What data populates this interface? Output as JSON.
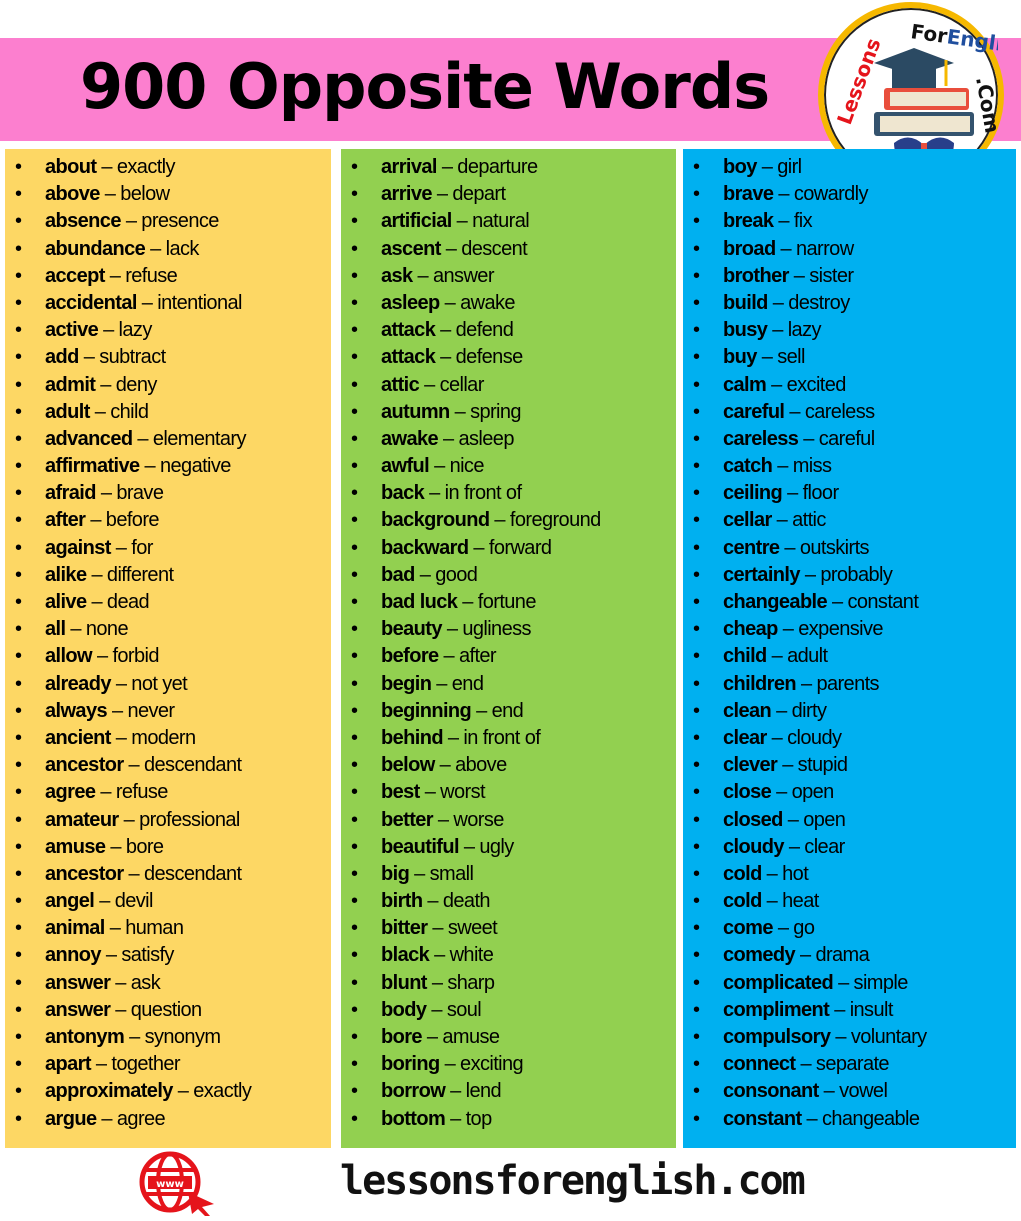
{
  "header": {
    "title": "900 Opposite Words"
  },
  "logo": {
    "text": "LessonsForEnglish.Com"
  },
  "footer": {
    "url": "lessonsforenglish.com",
    "icon": "www-globe-icon"
  },
  "colors": {
    "banner": "#fc7fcf",
    "column1": "#fdd764",
    "column2": "#92d050",
    "column3": "#00b0f0"
  },
  "columns": [
    [
      [
        "about",
        "exactly"
      ],
      [
        "above",
        "below"
      ],
      [
        "absence",
        "presence"
      ],
      [
        "abundance",
        "lack"
      ],
      [
        "accept",
        "refuse"
      ],
      [
        "accidental",
        "intentional"
      ],
      [
        "active",
        "lazy"
      ],
      [
        "add",
        "subtract"
      ],
      [
        "admit",
        "deny"
      ],
      [
        "adult",
        "child"
      ],
      [
        "advanced",
        "elementary"
      ],
      [
        "affirmative",
        "negative"
      ],
      [
        "afraid",
        "brave"
      ],
      [
        "after",
        "before"
      ],
      [
        "against",
        "for"
      ],
      [
        "alike",
        "different"
      ],
      [
        "alive",
        "dead"
      ],
      [
        "all",
        "none"
      ],
      [
        "allow",
        "forbid"
      ],
      [
        "already",
        "not yet"
      ],
      [
        "always",
        "never"
      ],
      [
        "ancient",
        "modern"
      ],
      [
        "ancestor",
        "descendant"
      ],
      [
        "agree",
        "refuse"
      ],
      [
        "amateur",
        "professional"
      ],
      [
        "amuse",
        "bore"
      ],
      [
        "ancestor",
        "descendant"
      ],
      [
        "angel",
        "devil"
      ],
      [
        "animal",
        "human"
      ],
      [
        "annoy",
        "satisfy"
      ],
      [
        "answer",
        "ask"
      ],
      [
        "answer",
        "question"
      ],
      [
        "antonym",
        "synonym"
      ],
      [
        "apart",
        "together"
      ],
      [
        "approximately",
        "exactly"
      ],
      [
        "argue",
        "agree"
      ]
    ],
    [
      [
        "arrival",
        "departure"
      ],
      [
        "arrive",
        "depart"
      ],
      [
        "artificial",
        "natural"
      ],
      [
        "ascent",
        "descent"
      ],
      [
        "ask",
        "answer"
      ],
      [
        "asleep",
        "awake"
      ],
      [
        "attack",
        "defend"
      ],
      [
        "attack",
        "defense"
      ],
      [
        "attic",
        "cellar"
      ],
      [
        "autumn",
        "spring"
      ],
      [
        "awake",
        "asleep"
      ],
      [
        "awful",
        "nice"
      ],
      [
        "back",
        "in front of"
      ],
      [
        "background",
        "foreground"
      ],
      [
        "backward",
        "forward"
      ],
      [
        "bad",
        "good"
      ],
      [
        "bad luck",
        "fortune"
      ],
      [
        "beauty",
        "ugliness"
      ],
      [
        "before",
        "after"
      ],
      [
        "begin",
        "end"
      ],
      [
        "beginning",
        "end"
      ],
      [
        "behind",
        "in front of"
      ],
      [
        "below",
        "above"
      ],
      [
        "best",
        "worst"
      ],
      [
        "better",
        "worse"
      ],
      [
        "beautiful",
        "ugly"
      ],
      [
        "big",
        "small"
      ],
      [
        "birth",
        "death"
      ],
      [
        "bitter",
        "sweet"
      ],
      [
        "black",
        "white"
      ],
      [
        "blunt",
        "sharp"
      ],
      [
        "body",
        "soul"
      ],
      [
        "bore",
        "amuse"
      ],
      [
        "boring",
        "exciting"
      ],
      [
        "borrow",
        "lend"
      ],
      [
        "bottom",
        "top"
      ]
    ],
    [
      [
        "boy",
        "girl"
      ],
      [
        "brave",
        "cowardly"
      ],
      [
        "break",
        "fix"
      ],
      [
        "broad",
        "narrow"
      ],
      [
        "brother",
        "sister"
      ],
      [
        "build",
        "destroy"
      ],
      [
        "busy",
        "lazy"
      ],
      [
        "buy",
        "sell"
      ],
      [
        "calm",
        "excited"
      ],
      [
        "careful",
        "careless"
      ],
      [
        "careless",
        "careful"
      ],
      [
        "catch",
        "miss"
      ],
      [
        "ceiling",
        "floor"
      ],
      [
        "cellar",
        "attic"
      ],
      [
        "centre",
        "outskirts"
      ],
      [
        "certainly",
        "probably"
      ],
      [
        "changeable",
        "constant"
      ],
      [
        "cheap",
        "expensive"
      ],
      [
        "child",
        "adult"
      ],
      [
        "children",
        "parents"
      ],
      [
        "clean",
        "dirty"
      ],
      [
        "clear",
        "cloudy"
      ],
      [
        "clever",
        "stupid"
      ],
      [
        "close",
        "open"
      ],
      [
        "closed",
        "open"
      ],
      [
        "cloudy",
        "clear"
      ],
      [
        "cold",
        "hot"
      ],
      [
        "cold",
        "heat"
      ],
      [
        "come",
        "go"
      ],
      [
        "comedy",
        "drama"
      ],
      [
        "complicated",
        "simple"
      ],
      [
        "compliment",
        "insult"
      ],
      [
        "compulsory",
        "voluntary"
      ],
      [
        "connect",
        "separate"
      ],
      [
        "consonant",
        "vowel"
      ],
      [
        "constant",
        "changeable"
      ]
    ]
  ]
}
